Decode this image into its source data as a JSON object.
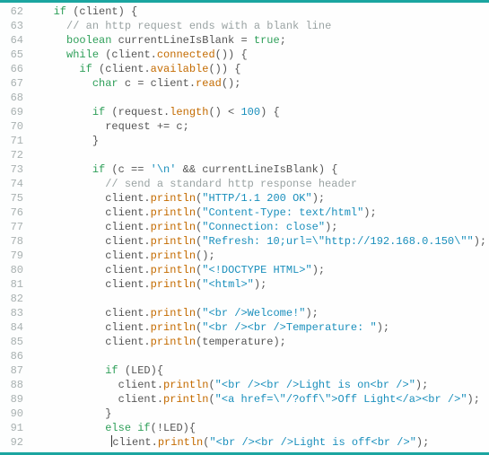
{
  "lines": [
    {
      "num": "62",
      "indent": "   ",
      "tokens": [
        {
          "cls": "kw",
          "t": "if"
        },
        {
          "cls": "p",
          "t": " (client) {"
        }
      ]
    },
    {
      "num": "63",
      "indent": "     ",
      "tokens": [
        {
          "cls": "cm",
          "t": "// an http request ends with a blank line"
        }
      ]
    },
    {
      "num": "64",
      "indent": "     ",
      "tokens": [
        {
          "cls": "kw",
          "t": "boolean"
        },
        {
          "cls": "p",
          "t": " currentLineIsBlank = "
        },
        {
          "cls": "kw",
          "t": "true"
        },
        {
          "cls": "p",
          "t": ";"
        }
      ]
    },
    {
      "num": "65",
      "indent": "     ",
      "tokens": [
        {
          "cls": "kw",
          "t": "while"
        },
        {
          "cls": "p",
          "t": " (client."
        },
        {
          "cls": "mth",
          "t": "connected"
        },
        {
          "cls": "p",
          "t": "()) {"
        }
      ]
    },
    {
      "num": "66",
      "indent": "       ",
      "tokens": [
        {
          "cls": "kw",
          "t": "if"
        },
        {
          "cls": "p",
          "t": " (client."
        },
        {
          "cls": "mth",
          "t": "available"
        },
        {
          "cls": "p",
          "t": "()) {"
        }
      ]
    },
    {
      "num": "67",
      "indent": "         ",
      "tokens": [
        {
          "cls": "kw",
          "t": "char"
        },
        {
          "cls": "p",
          "t": " c = client."
        },
        {
          "cls": "mth",
          "t": "read"
        },
        {
          "cls": "p",
          "t": "();"
        }
      ]
    },
    {
      "num": "68",
      "indent": "",
      "tokens": []
    },
    {
      "num": "69",
      "indent": "         ",
      "tokens": [
        {
          "cls": "kw",
          "t": "if"
        },
        {
          "cls": "p",
          "t": " (request."
        },
        {
          "cls": "mth",
          "t": "length"
        },
        {
          "cls": "p",
          "t": "() < "
        },
        {
          "cls": "num",
          "t": "100"
        },
        {
          "cls": "p",
          "t": ") {"
        }
      ]
    },
    {
      "num": "70",
      "indent": "           ",
      "tokens": [
        {
          "cls": "p",
          "t": "request += c;"
        }
      ]
    },
    {
      "num": "71",
      "indent": "         ",
      "tokens": [
        {
          "cls": "p",
          "t": "}"
        }
      ]
    },
    {
      "num": "72",
      "indent": "",
      "tokens": []
    },
    {
      "num": "73",
      "indent": "         ",
      "tokens": [
        {
          "cls": "kw",
          "t": "if"
        },
        {
          "cls": "p",
          "t": " (c == "
        },
        {
          "cls": "num",
          "t": "'\\n'"
        },
        {
          "cls": "p",
          "t": " && currentLineIsBlank) {"
        }
      ]
    },
    {
      "num": "74",
      "indent": "           ",
      "tokens": [
        {
          "cls": "cm",
          "t": "// send a standard http response header"
        }
      ]
    },
    {
      "num": "75",
      "indent": "           ",
      "tokens": [
        {
          "cls": "p",
          "t": "client."
        },
        {
          "cls": "mth",
          "t": "println"
        },
        {
          "cls": "p",
          "t": "("
        },
        {
          "cls": "str",
          "t": "\"HTTP/1.1 200 OK\""
        },
        {
          "cls": "p",
          "t": ");"
        }
      ]
    },
    {
      "num": "76",
      "indent": "           ",
      "tokens": [
        {
          "cls": "p",
          "t": "client."
        },
        {
          "cls": "mth",
          "t": "println"
        },
        {
          "cls": "p",
          "t": "("
        },
        {
          "cls": "str",
          "t": "\"Content-Type: text/html\""
        },
        {
          "cls": "p",
          "t": ");"
        }
      ]
    },
    {
      "num": "77",
      "indent": "           ",
      "tokens": [
        {
          "cls": "p",
          "t": "client."
        },
        {
          "cls": "mth",
          "t": "println"
        },
        {
          "cls": "p",
          "t": "("
        },
        {
          "cls": "str",
          "t": "\"Connection: close\""
        },
        {
          "cls": "p",
          "t": ");"
        }
      ]
    },
    {
      "num": "78",
      "indent": "           ",
      "tokens": [
        {
          "cls": "p",
          "t": "client."
        },
        {
          "cls": "mth",
          "t": "println"
        },
        {
          "cls": "p",
          "t": "("
        },
        {
          "cls": "str",
          "t": "\"Refresh: 10;url=\\\"http://192.168.0.150\\\"\""
        },
        {
          "cls": "p",
          "t": ");"
        }
      ]
    },
    {
      "num": "79",
      "indent": "           ",
      "tokens": [
        {
          "cls": "p",
          "t": "client."
        },
        {
          "cls": "mth",
          "t": "println"
        },
        {
          "cls": "p",
          "t": "();"
        }
      ]
    },
    {
      "num": "80",
      "indent": "           ",
      "tokens": [
        {
          "cls": "p",
          "t": "client."
        },
        {
          "cls": "mth",
          "t": "println"
        },
        {
          "cls": "p",
          "t": "("
        },
        {
          "cls": "str",
          "t": "\"<!DOCTYPE HTML>\""
        },
        {
          "cls": "p",
          "t": ");"
        }
      ]
    },
    {
      "num": "81",
      "indent": "           ",
      "tokens": [
        {
          "cls": "p",
          "t": "client."
        },
        {
          "cls": "mth",
          "t": "println"
        },
        {
          "cls": "p",
          "t": "("
        },
        {
          "cls": "str",
          "t": "\"<html>\""
        },
        {
          "cls": "p",
          "t": ");"
        }
      ]
    },
    {
      "num": "82",
      "indent": "",
      "tokens": []
    },
    {
      "num": "83",
      "indent": "           ",
      "tokens": [
        {
          "cls": "p",
          "t": "client."
        },
        {
          "cls": "mth",
          "t": "println"
        },
        {
          "cls": "p",
          "t": "("
        },
        {
          "cls": "str",
          "t": "\"<br />Welcome!\""
        },
        {
          "cls": "p",
          "t": ");"
        }
      ]
    },
    {
      "num": "84",
      "indent": "           ",
      "tokens": [
        {
          "cls": "p",
          "t": "client."
        },
        {
          "cls": "mth",
          "t": "println"
        },
        {
          "cls": "p",
          "t": "("
        },
        {
          "cls": "str",
          "t": "\"<br /><br />Temperature: \""
        },
        {
          "cls": "p",
          "t": ");"
        }
      ]
    },
    {
      "num": "85",
      "indent": "           ",
      "tokens": [
        {
          "cls": "p",
          "t": "client."
        },
        {
          "cls": "mth",
          "t": "println"
        },
        {
          "cls": "p",
          "t": "(temperature);"
        }
      ]
    },
    {
      "num": "86",
      "indent": "",
      "tokens": []
    },
    {
      "num": "87",
      "indent": "           ",
      "tokens": [
        {
          "cls": "kw",
          "t": "if"
        },
        {
          "cls": "p",
          "t": " (LED){"
        }
      ]
    },
    {
      "num": "88",
      "indent": "             ",
      "tokens": [
        {
          "cls": "p",
          "t": "client."
        },
        {
          "cls": "mth",
          "t": "println"
        },
        {
          "cls": "p",
          "t": "("
        },
        {
          "cls": "str",
          "t": "\"<br /><br />Light is on<br />\""
        },
        {
          "cls": "p",
          "t": ");"
        }
      ]
    },
    {
      "num": "89",
      "indent": "             ",
      "tokens": [
        {
          "cls": "p",
          "t": "client."
        },
        {
          "cls": "mth",
          "t": "println"
        },
        {
          "cls": "p",
          "t": "("
        },
        {
          "cls": "str",
          "t": "\"<a href=\\\"/?off\\\">Off Light</a><br />\""
        },
        {
          "cls": "p",
          "t": ");"
        }
      ]
    },
    {
      "num": "90",
      "indent": "           ",
      "tokens": [
        {
          "cls": "p",
          "t": "}"
        }
      ]
    },
    {
      "num": "91",
      "indent": "           ",
      "tokens": [
        {
          "cls": "kw",
          "t": "else if"
        },
        {
          "cls": "p",
          "t": "(!LED){"
        }
      ]
    },
    {
      "num": "92",
      "indent": "            ",
      "caret": true,
      "tokens": [
        {
          "cls": "p",
          "t": "client."
        },
        {
          "cls": "mth",
          "t": "println"
        },
        {
          "cls": "p",
          "t": "("
        },
        {
          "cls": "str",
          "t": "\"<br /><br />Light is off<br />\""
        },
        {
          "cls": "p",
          "t": ");"
        }
      ]
    }
  ]
}
